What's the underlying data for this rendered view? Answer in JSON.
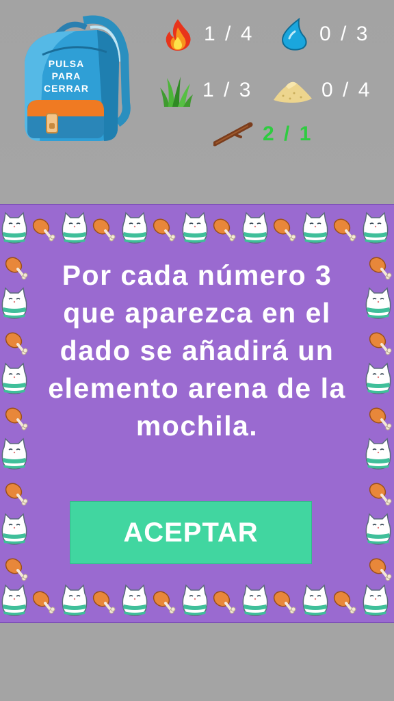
{
  "backpack": {
    "label": "PULSA\nPARA\nCERRAR",
    "icon": "backpack-icon"
  },
  "resources": {
    "fire": {
      "icon": "fire-icon",
      "count": "1 / 4"
    },
    "water": {
      "icon": "water-drop-icon",
      "count": "0 / 3"
    },
    "grass": {
      "icon": "grass-icon",
      "count": "1 / 3"
    },
    "sand": {
      "icon": "sand-pile-icon",
      "count": "0 / 4"
    },
    "stick": {
      "icon": "stick-icon",
      "count": "2 / 1",
      "complete": true
    }
  },
  "dialog": {
    "message": "Por cada número 3 que aparezca en el dado se añadirá un elemento arena de la mochila.",
    "accept_label": "ACEPTAR",
    "background": "#9a6ad0",
    "button_color": "#41d6a0"
  }
}
